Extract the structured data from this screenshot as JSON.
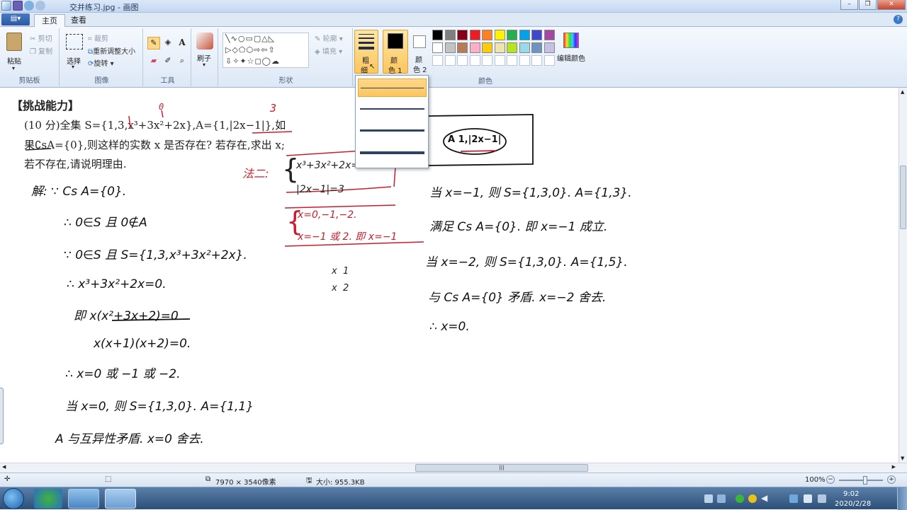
{
  "window": {
    "title": "交并练习.jpg - 画图"
  },
  "tabs": {
    "file": "▤▾",
    "home": "主页",
    "view": "查看"
  },
  "ribbon": {
    "clipboard": {
      "paste": "粘贴",
      "cut": "剪切",
      "copy": "复制",
      "label": "剪贴板"
    },
    "image": {
      "select": "选择",
      "crop": "裁剪",
      "resize": "重新调整大小",
      "rotate": "旋转",
      "label": "图像"
    },
    "tools": {
      "label": "工具"
    },
    "brushes": {
      "label": "刷子"
    },
    "shapes": {
      "outline": "轮廓",
      "fill": "填充",
      "label": "形状"
    },
    "size": {
      "label_line1": "粗",
      "label_line2": "细"
    },
    "color1": {
      "line1": "颜",
      "line2": "色 1"
    },
    "color2": {
      "line1": "颜",
      "line2": "色 2"
    },
    "edit_colors": "编辑颜色",
    "colors_label": "颜色",
    "palette_row1": [
      "#000000",
      "#7f7f7f",
      "#880015",
      "#ed1c24",
      "#ff7f27",
      "#fff200",
      "#22b14c",
      "#00a2e8",
      "#3f48cc",
      "#a349a4"
    ],
    "palette_row2": [
      "#ffffff",
      "#c3c3c3",
      "#b97a57",
      "#ffaec9",
      "#ffc90e",
      "#efe4b0",
      "#b5e61d",
      "#99d9ea",
      "#7092be",
      "#c8bfe7"
    ]
  },
  "document": {
    "heading": "【挑战能力】",
    "line1": "(10 分)全集 S={1,3,x³+3x²+2x},A={1,|2x−1|},如",
    "line2": "果∁sA={0},则这样的实数 x 是否存在? 若存在,求出 x;",
    "line3": "若不存在,请说明理由.",
    "annot_top1": "0",
    "annot_top2": "3",
    "box_note": "A 1,|2x−1|",
    "red_label": "法二:",
    "red_eq1": "x³+3x²+2x=0",
    "red_eq2": "|2x−1|=3",
    "red_sol1": "x=0,−1,−2.",
    "red_sol2": "x=−1 或 2. 即 x=−1",
    "mid_a": "x  1",
    "mid_b": "x  2",
    "sol": [
      "解: ∵ Cs A={0}.",
      "∴ 0∈S 且 0∉A",
      "∵ 0∈S 且 S={1,3,x³+3x²+2x}.",
      "∴ x³+3x²+2x=0.",
      "即 x(x²+3x+2)=0",
      "x(x+1)(x+2)=0.",
      "∴ x=0 或 −1 或 −2.",
      "当 x=0, 则 S={1,3,0}. A={1,1}",
      "A 与互异性矛盾. x=0 舍去."
    ],
    "right": [
      "当 x=−1, 则 S={1,3,0}. A={1,3}.",
      "满足 Cs A={0}. 即 x=−1 成立.",
      "当 x=−2, 则 S={1,3,0}. A={1,5}.",
      "与 Cs A={0} 矛盾. x=−2 舍去.",
      "∴ x=0."
    ]
  },
  "status": {
    "dimensions": "7970 × 3540像素",
    "filesize": "大小: 955.3KB",
    "zoom": "100%"
  },
  "taskbar": {
    "time": "9:02",
    "date": "2020/2/28"
  }
}
